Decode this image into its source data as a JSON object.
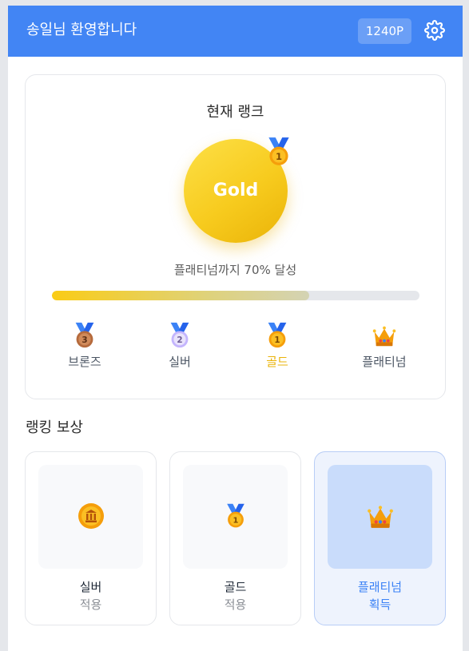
{
  "header": {
    "greeting": "송일님 환영합니다",
    "points": "1240P",
    "settings_icon": "gear-icon"
  },
  "rank": {
    "title": "현재 랭크",
    "current": "Gold",
    "badge_icon": "gold-medal-icon",
    "progress_text": "플래티넘까지 70% 달성",
    "progress_fraction": 0.7,
    "progress_color": "#facc15",
    "tiers": [
      {
        "label": "브론즈",
        "icon": "bronze-medal-icon",
        "active": false
      },
      {
        "label": "실버",
        "icon": "silver-medal-icon",
        "active": false
      },
      {
        "label": "골드",
        "icon": "gold-medal-icon",
        "active": true
      },
      {
        "label": "플래티넘",
        "icon": "crown-icon",
        "active": false
      }
    ]
  },
  "rewards": {
    "title": "랭킹 보상",
    "items": [
      {
        "name": "실버",
        "status": "적용",
        "icon": "coin-icon",
        "selected": false
      },
      {
        "name": "골드",
        "status": "적용",
        "icon": "gold-medal-icon",
        "selected": false
      },
      {
        "name": "플래티넘",
        "status": "획득",
        "icon": "crown-icon",
        "selected": true
      }
    ]
  },
  "colors": {
    "header": "#4285f4",
    "gold": "#eab308",
    "accent_blue": "#3b82f6"
  }
}
